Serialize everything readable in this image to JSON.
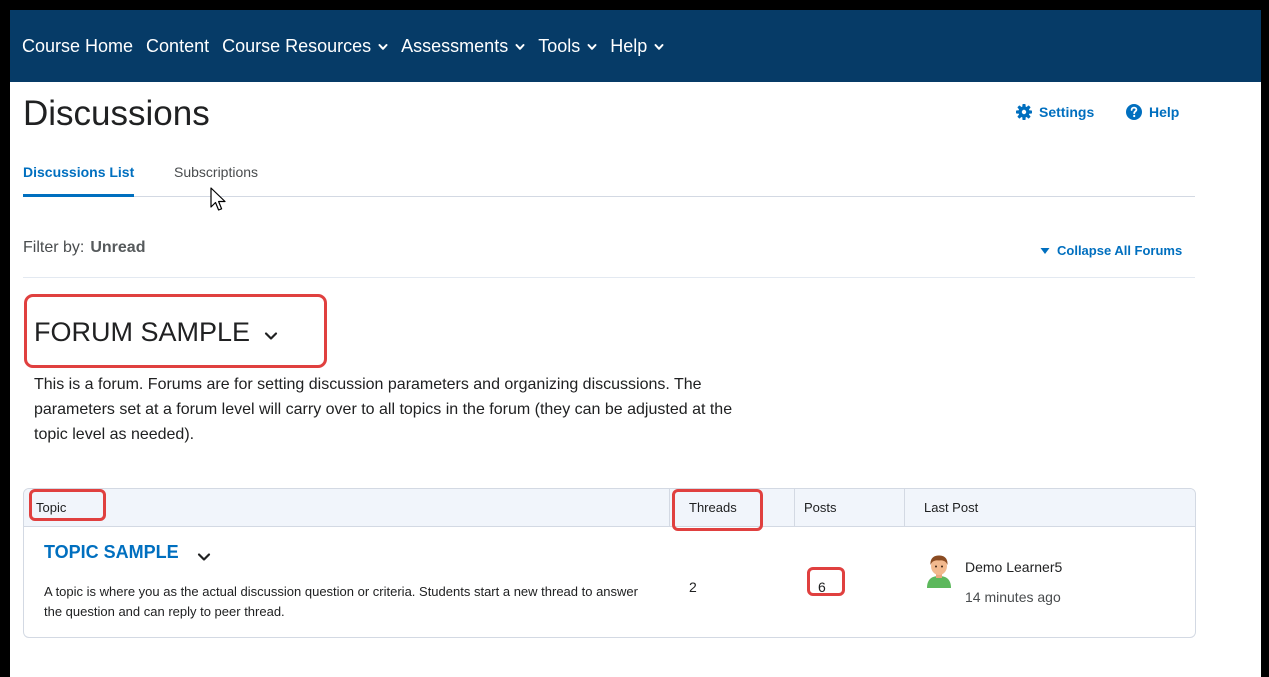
{
  "nav": {
    "items": [
      {
        "label": "Course Home",
        "dropdown": false
      },
      {
        "label": "Content",
        "dropdown": false
      },
      {
        "label": "Course Resources",
        "dropdown": true
      },
      {
        "label": "Assessments",
        "dropdown": true
      },
      {
        "label": "Tools",
        "dropdown": true
      },
      {
        "label": "Help",
        "dropdown": true
      }
    ]
  },
  "page": {
    "title": "Discussions",
    "settings_label": "Settings",
    "help_label": "Help"
  },
  "tabs": {
    "list_label": "Discussions List",
    "subscriptions_label": "Subscriptions"
  },
  "filter": {
    "prefix": "Filter by:",
    "value": "Unread",
    "collapse_label": "Collapse All Forums"
  },
  "forum": {
    "title": "FORUM SAMPLE",
    "description": "This is a forum. Forums are for setting discussion parameters and organizing discussions. The parameters set at a forum level will carry over to all topics in the forum (they can be adjusted at the topic level as needed)."
  },
  "table": {
    "headers": {
      "topic": "Topic",
      "threads": "Threads",
      "posts": "Posts",
      "last_post": "Last Post"
    },
    "row": {
      "title": "TOPIC SAMPLE",
      "description": "A topic is where you as the actual discussion question or criteria. Students start a new thread to answer the question and can reply to peer thread.",
      "threads": "2",
      "posts": "6",
      "last_post_user": "Demo Learner5",
      "last_post_time": "14 minutes ago"
    }
  },
  "colors": {
    "navbar": "#063b67",
    "link": "#006fbf",
    "highlight": "#e0403f"
  }
}
